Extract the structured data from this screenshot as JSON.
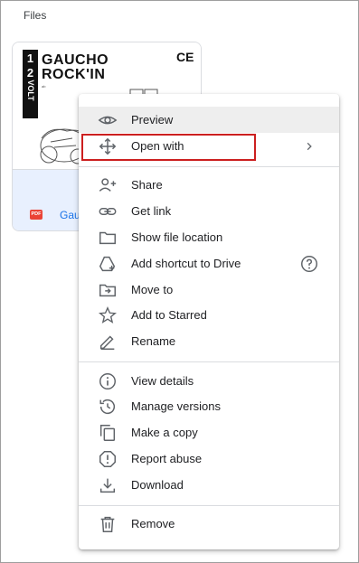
{
  "header": {
    "title": "Files"
  },
  "file_card": {
    "name": "Gauc",
    "type_badge": "PDF",
    "thumbnail": {
      "brand_line1": "GAUCHO",
      "brand_line2": "ROCK'IN",
      "brand_sub": "ab",
      "volt_1": "1",
      "volt_2": "2",
      "volt_word": "VOLT",
      "ce_mark": "CE"
    }
  },
  "context_menu": {
    "items": [
      {
        "label": "Preview",
        "icon": "eye-icon"
      },
      {
        "label": "Open with",
        "icon": "move-arrows-icon",
        "trailing": "chevron-right-icon"
      },
      {
        "label": "Share",
        "icon": "person-add-icon"
      },
      {
        "label": "Get link",
        "icon": "link-icon"
      },
      {
        "label": "Show file location",
        "icon": "folder-icon"
      },
      {
        "label": "Add shortcut to Drive",
        "icon": "drive-shortcut-icon",
        "trailing": "help-icon"
      },
      {
        "label": "Move to",
        "icon": "folder-move-icon"
      },
      {
        "label": "Add to Starred",
        "icon": "star-icon"
      },
      {
        "label": "Rename",
        "icon": "pencil-icon"
      },
      {
        "label": "View details",
        "icon": "info-icon"
      },
      {
        "label": "Manage versions",
        "icon": "history-icon"
      },
      {
        "label": "Make a copy",
        "icon": "copy-icon"
      },
      {
        "label": "Report abuse",
        "icon": "report-icon"
      },
      {
        "label": "Download",
        "icon": "download-icon"
      },
      {
        "label": "Remove",
        "icon": "trash-icon"
      }
    ]
  },
  "colors": {
    "highlight_border": "#cc1f1f",
    "active_row": "#eeeeee",
    "pdf_badge": "#ea4335",
    "link_blue": "#1a73e8"
  }
}
